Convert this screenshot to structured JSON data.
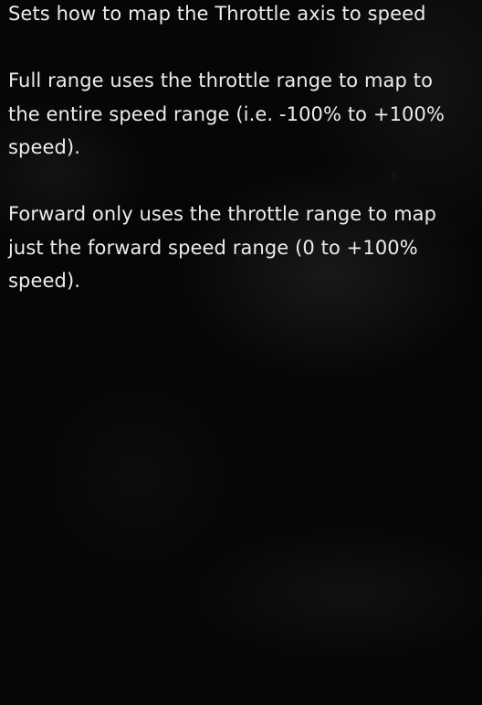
{
  "tooltip": {
    "paragraphs": [
      "Sets how to map the Throttle axis to speed",
      "Full range uses the throttle range to map to the entire speed range (i.e. -100% to +100% speed).",
      "Forward only uses the throttle range to map just the forward speed range (0 to +100% speed)."
    ]
  }
}
